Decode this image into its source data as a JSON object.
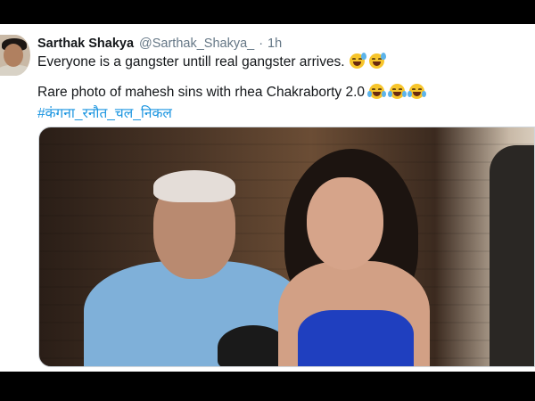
{
  "tweet": {
    "display_name": "Sarthak Shakya",
    "handle": "@Sarthak_Shakya_",
    "separator": "·",
    "time": "1h",
    "line1": "Everyone is a gangster untill real gangster arrives.",
    "line2": "Rare photo of mahesh sins with rhea Chakraborty 2.0",
    "hashtag": "#कंगना_रनौत_चल_निकल"
  },
  "icons": {
    "avatar": "profile-photo",
    "emoji_line1": [
      "grinning-squinting-sweat-emoji",
      "grinning-sweat-emoji"
    ],
    "emoji_line2": [
      "tears-of-joy-emoji",
      "tears-of-joy-emoji",
      "tears-of-joy-emoji"
    ]
  },
  "colors": {
    "link": "#1b95e0",
    "text": "#14171a",
    "muted": "#657786"
  }
}
